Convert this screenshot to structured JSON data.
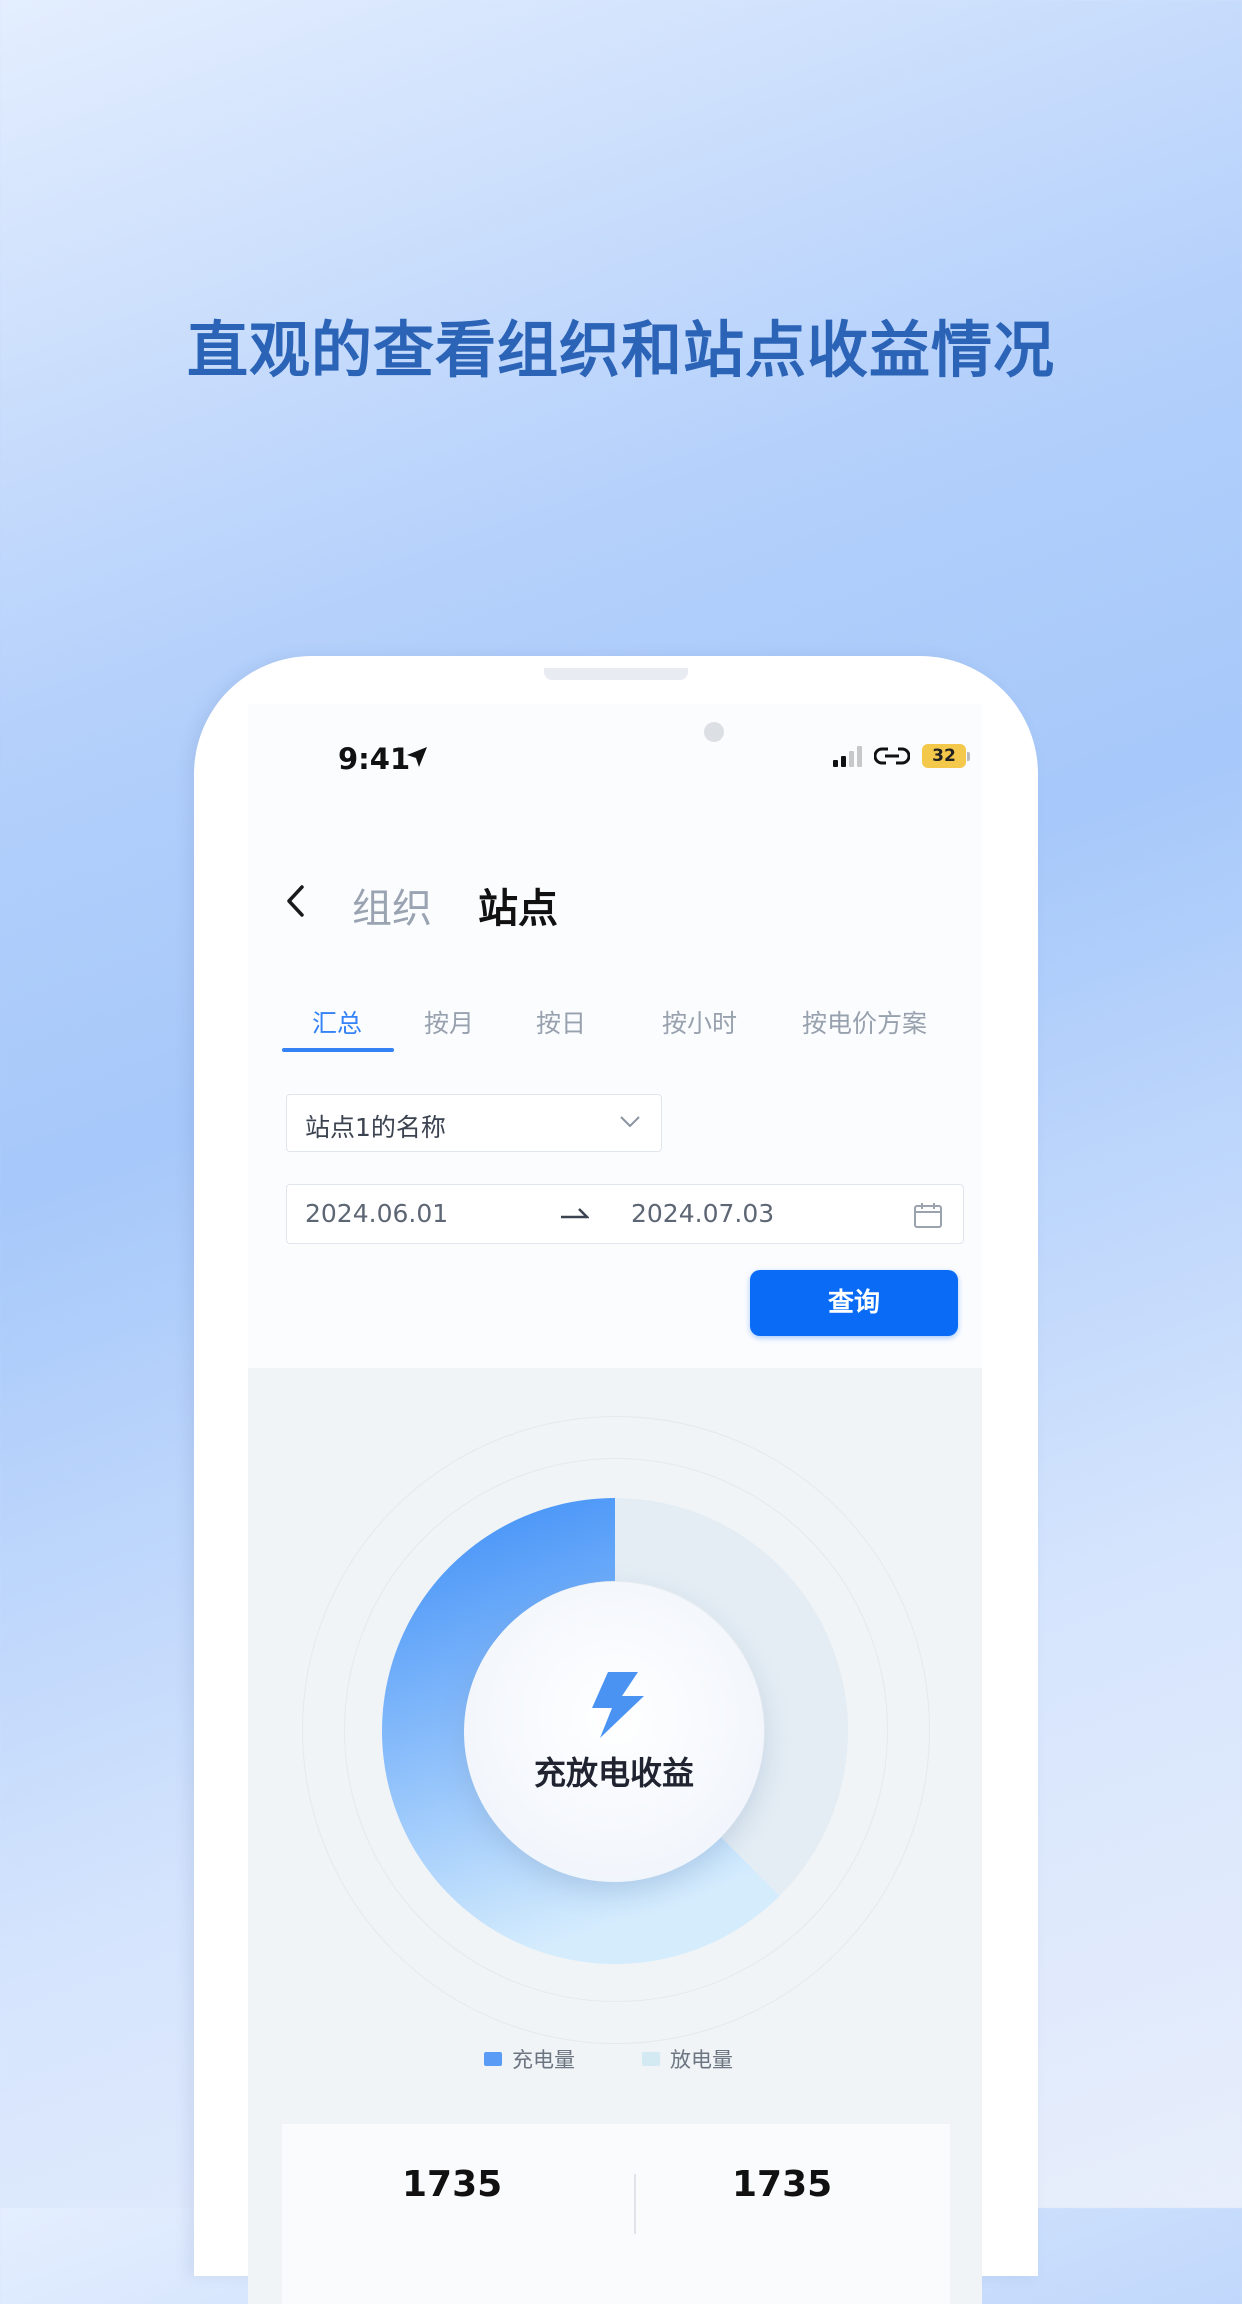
{
  "headline": "直观的查看组织和站点收益情况",
  "status_bar": {
    "time": "9:41",
    "battery": "32"
  },
  "nav": {
    "org_label": "组织",
    "site_label": "站点"
  },
  "tabs": [
    {
      "label": "汇总",
      "active": true
    },
    {
      "label": "按月",
      "active": false
    },
    {
      "label": "按日",
      "active": false
    },
    {
      "label": "按小时",
      "active": false
    },
    {
      "label": "按电价方案",
      "active": false
    }
  ],
  "filters": {
    "site_select": "站点1的名称",
    "date_start": "2024.06.01",
    "date_end": "2024.07.03",
    "query_button": "查询"
  },
  "chart_data": {
    "type": "pie",
    "title": "充放电收益",
    "series": [
      {
        "name": "充电量",
        "value": 62.5,
        "color": "#3a8cf7"
      },
      {
        "name": "放电量",
        "value": 37.5,
        "color": "#e4edf4"
      }
    ]
  },
  "legend": {
    "charge": "充电量",
    "discharge": "放电量"
  },
  "stats": {
    "left_value": "1735",
    "right_value": "1735"
  }
}
